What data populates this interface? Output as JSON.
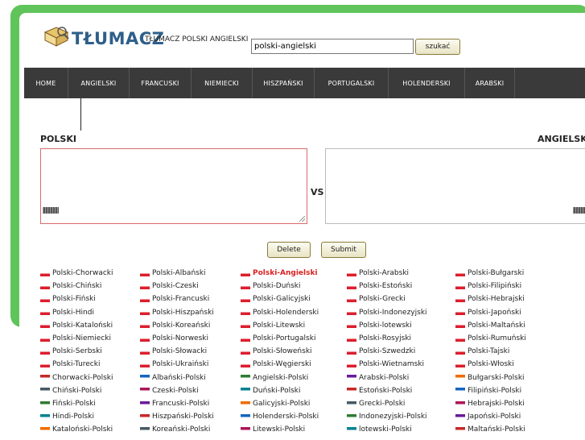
{
  "header": {
    "brand": "TŁUMACZ",
    "tagline": "TŁUMACZ POLSKI ANGIELSKI",
    "search_value": "polski-angielski",
    "search_button": "szukać"
  },
  "nav": {
    "items": [
      {
        "label": "HOME"
      },
      {
        "label": "ANGIELSKI"
      },
      {
        "label": "FRANCUSKI"
      },
      {
        "label": "NIEMIECKI"
      },
      {
        "label": "HISZPAŃSKI"
      },
      {
        "label": "PORTUGALSKI"
      },
      {
        "label": "HOLENDERSKI"
      },
      {
        "label": "ARABSKI"
      }
    ]
  },
  "translator": {
    "source_lang": "POLSKI",
    "target_lang": "ANGIELSKI",
    "vs": "VS",
    "delete_button": "Delete",
    "submit_button": "Submit"
  },
  "links": [
    [
      "Polski-Chorwacki",
      "Polski-Albański",
      "Polski-Angielski",
      "Polski-Arabski",
      "Polski-Bułgarski"
    ],
    [
      "Polski-Chiński",
      "Polski-Czeski",
      "Polski-Duński",
      "Polski-Estoński",
      "Polski-Filipiński"
    ],
    [
      "Polski-Fiński",
      "Polski-Francuski",
      "Polski-Galicyjski",
      "Polski-Grecki",
      "Polski-Hebrajski"
    ],
    [
      "Polski-Hindi",
      "Polski-Hiszpański",
      "Polski-Holenderski",
      "Polski-Indonezyjski",
      "Polski-Japoński"
    ],
    [
      "Polski-Kataloński",
      "Polski-Koreański",
      "Polski-Litewski",
      "Polski-lotewski",
      "Polski-Maltański"
    ],
    [
      "Polski-Niemiecki",
      "Polski-Norweski",
      "Polski-Portugalski",
      "Polski-Rosyjski",
      "Polski-Rumuński"
    ],
    [
      "Polski-Serbski",
      "Polski-Słowacki",
      "Polski-Słoweński",
      "Polski-Szwedzki",
      "Polski-Tajski"
    ],
    [
      "Polski-Turecki",
      "Polski-Ukraiński",
      "Polski-Węgierski",
      "Polski-Wietnamski",
      "Polski-Włoski"
    ],
    [
      "Chorwacki-Polski",
      "Albański-Polski",
      "Angielski-Polski",
      "Arabski-Polski",
      "Bułgarski-Polski"
    ],
    [
      "Chiński-Polski",
      "Czeski-Polski",
      "Duński-Polski",
      "Estoński-Polski",
      "Filipiński-Polski"
    ],
    [
      "Fiński-Polski",
      "Francuski-Polski",
      "Galicyjski-Polski",
      "Grecki-Polski",
      "Hebrajski-Polski"
    ],
    [
      "Hindi-Polski",
      "Hiszpański-Polski",
      "Holenderski-Polski",
      "Indonezyjski-Polski",
      "Japoński-Polski"
    ],
    [
      "Kataloński-Polski",
      "Koreański-Polski",
      "Litewski-Polski",
      "lotewski-Polski",
      "Maltański-Polski"
    ]
  ],
  "active_link": "Polski-Angielski",
  "colors": {
    "frame_green": "#5fc45a",
    "nav_bg": "#3a3a3a",
    "brand": "#2e5f8a",
    "active_link": "#d91f1f"
  }
}
